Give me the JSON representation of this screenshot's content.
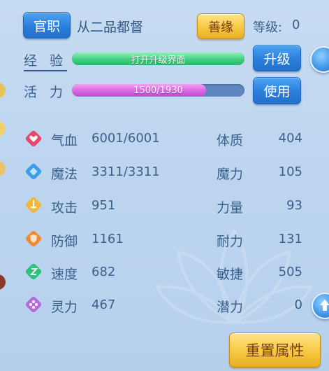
{
  "header": {
    "official_button": "官职",
    "rank": "从二品都督",
    "karma_button": "善缘",
    "level_label": "等级:",
    "level_value": "0"
  },
  "experience": {
    "label": "经 验",
    "bar_text": "打开升级界面",
    "fill": 1.0,
    "upgrade_button": "升级"
  },
  "vitality": {
    "label": "活 力",
    "bar_text": "1500/1930",
    "current": 1500,
    "max": 1930,
    "use_button": "使用"
  },
  "stats": [
    {
      "icon": "heart-icon",
      "label": "气血",
      "value": "6001/6001",
      "color": "#e5486a"
    },
    {
      "icon": "mana-diamond-icon",
      "label": "魔法",
      "value": "3311/3311",
      "color": "#3e9de8"
    },
    {
      "icon": "sword-icon",
      "label": "攻击",
      "value": "951",
      "color": "#f0b93a"
    },
    {
      "icon": "shield-icon",
      "label": "防御",
      "value": "1161",
      "color": "#f08a35"
    },
    {
      "icon": "speed-icon",
      "label": "速度",
      "value": "682",
      "color": "#2fc27b"
    },
    {
      "icon": "spirit-icon",
      "label": "灵力",
      "value": "467",
      "color": "#b56be0"
    }
  ],
  "attributes": [
    {
      "label": "体质",
      "value": "404"
    },
    {
      "label": "魔力",
      "value": "105"
    },
    {
      "label": "力量",
      "value": "93"
    },
    {
      "label": "耐力",
      "value": "131"
    },
    {
      "label": "敏捷",
      "value": "505"
    },
    {
      "label": "潜力",
      "value": "0"
    }
  ],
  "footer": {
    "reset_button": "重置属性"
  }
}
